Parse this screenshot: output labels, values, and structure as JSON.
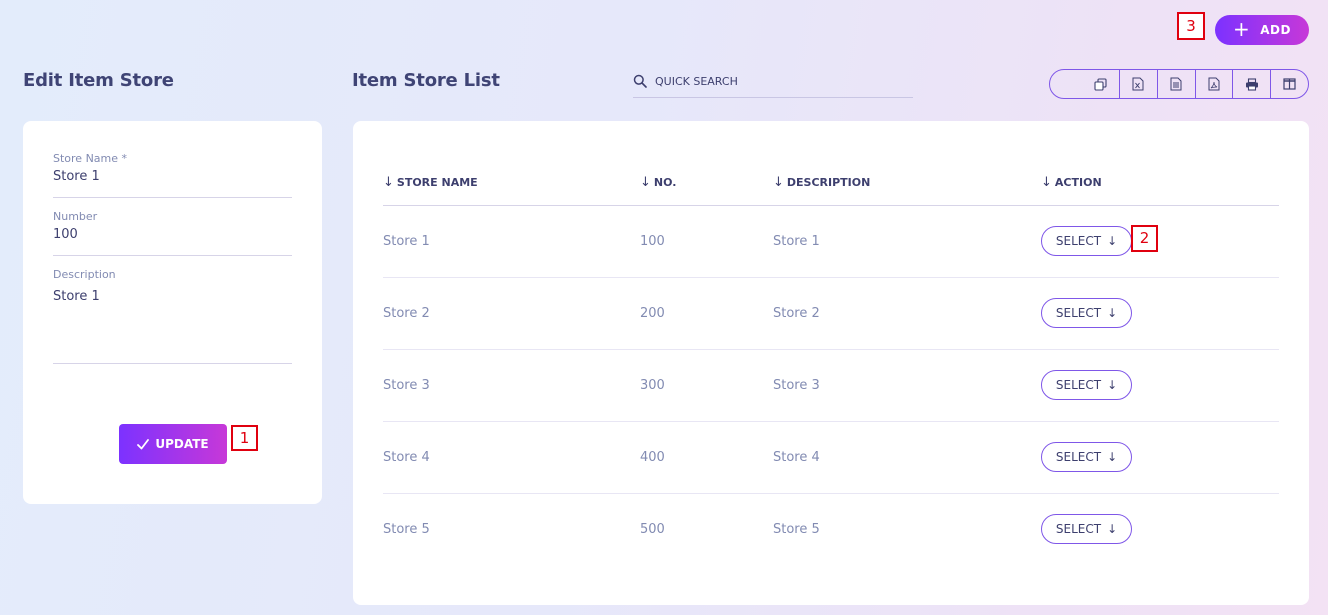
{
  "left_panel": {
    "title": "Edit Item Store",
    "fields": {
      "store_name": {
        "label": "Store Name *",
        "value": "Store 1"
      },
      "number": {
        "label": "Number",
        "value": "100"
      },
      "description": {
        "label": "Description",
        "value": "Store 1"
      }
    },
    "update_label": "UPDATE",
    "update_icon": "check-icon"
  },
  "right_panel": {
    "title": "Item Store List",
    "search": {
      "placeholder": "QUICK SEARCH",
      "icon": "search-icon"
    },
    "toolbar": [
      "copy-icon",
      "excel-icon",
      "csv-icon",
      "pdf-icon",
      "print-icon",
      "columns-icon"
    ],
    "add_label": "ADD",
    "columns": [
      "STORE NAME",
      "NO.",
      "DESCRIPTION",
      "ACTION"
    ],
    "rows": [
      {
        "name": "Store 1",
        "no": "100",
        "description": "Store 1",
        "action": "SELECT"
      },
      {
        "name": "Store 2",
        "no": "200",
        "description": "Store 2",
        "action": "SELECT"
      },
      {
        "name": "Store 3",
        "no": "300",
        "description": "Store 3",
        "action": "SELECT"
      },
      {
        "name": "Store 4",
        "no": "400",
        "description": "Store 4",
        "action": "SELECT"
      },
      {
        "name": "Store 5",
        "no": "500",
        "description": "Store 5",
        "action": "SELECT"
      }
    ]
  },
  "markers": [
    "1",
    "2",
    "3"
  ],
  "colors": {
    "accent_start": "#7c32ff",
    "accent_end": "#c738d8",
    "outline": "#7f57e8",
    "text": "#3d3f6e",
    "muted": "#828bb2",
    "marker": "#e0000f"
  }
}
